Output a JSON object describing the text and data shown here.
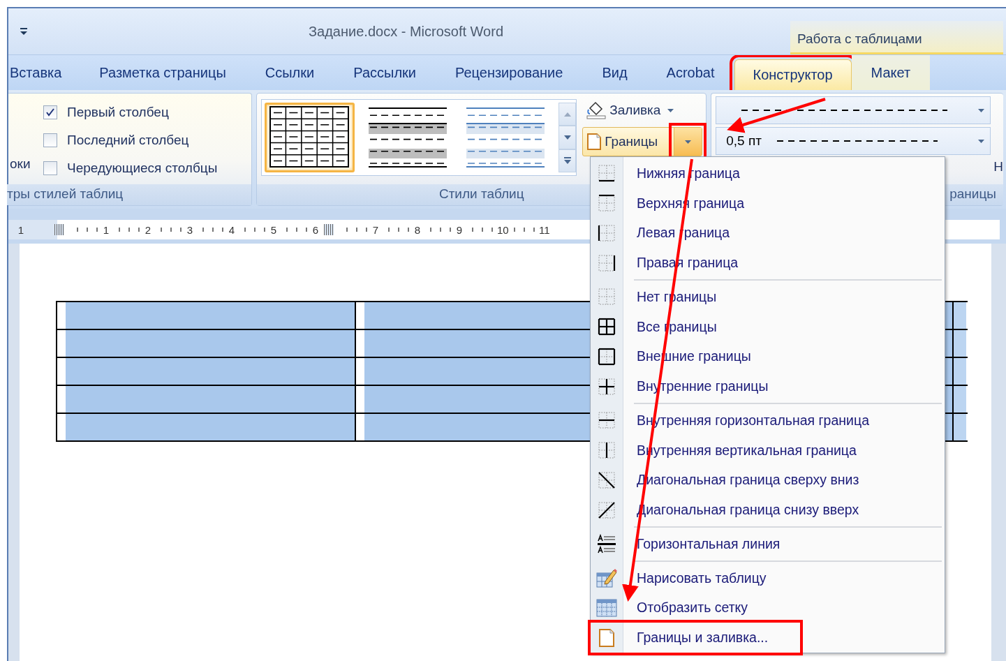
{
  "window": {
    "title": "Задание.docx - Microsoft Word"
  },
  "contextual_group": "Работа с таблицами",
  "tabs": [
    {
      "label": "Вставка",
      "selected": false,
      "contextual": false,
      "marked": false
    },
    {
      "label": "Разметка страницы",
      "selected": false,
      "contextual": false,
      "marked": false
    },
    {
      "label": "Ссылки",
      "selected": false,
      "contextual": false,
      "marked": false
    },
    {
      "label": "Рассылки",
      "selected": false,
      "contextual": false,
      "marked": false
    },
    {
      "label": "Рецензирование",
      "selected": false,
      "contextual": false,
      "marked": false
    },
    {
      "label": "Вид",
      "selected": false,
      "contextual": false,
      "marked": false
    },
    {
      "label": "Acrobat",
      "selected": false,
      "contextual": false,
      "marked": false
    },
    {
      "label": "Конструктор",
      "selected": true,
      "contextual": true,
      "marked": true
    },
    {
      "label": "Макет",
      "selected": false,
      "contextual": true,
      "marked": false
    }
  ],
  "ribbon": {
    "style_options": {
      "cut_label": "оки",
      "options": [
        {
          "label": "Первый столбец",
          "checked": true
        },
        {
          "label": "Последний столбец",
          "checked": false
        },
        {
          "label": "Чередующиеся столбцы",
          "checked": false
        }
      ],
      "group_label": "тры стилей таблиц"
    },
    "table_styles": {
      "styles": [
        {
          "kind": "grid",
          "selected": true
        },
        {
          "kind": "banded_gray",
          "selected": false
        },
        {
          "kind": "banded_blue",
          "selected": false
        }
      ],
      "shading": "Заливка",
      "borders": {
        "label": "Границы",
        "marked": true
      },
      "group_label": "Стили таблиц"
    },
    "draw_borders": {
      "weight": "0,5 пт",
      "cut_button": "Н",
      "group_label": "раницы"
    }
  },
  "ruler": {
    "labels": [
      "1",
      "1",
      "2",
      "3",
      "4",
      "5",
      "6",
      "7",
      "8",
      "9",
      "10",
      "11"
    ]
  },
  "table": {
    "rows": [
      {
        "selected": true
      },
      {
        "selected": true
      },
      {
        "selected": true
      },
      {
        "selected": true
      },
      {
        "selected": true
      }
    ]
  },
  "borders_menu": {
    "sections": [
      [
        {
          "label": "Нижняя граница",
          "marked": false
        },
        {
          "label": "Верхняя граница",
          "marked": false
        },
        {
          "label": "Левая граница",
          "marked": false
        },
        {
          "label": "Правая граница",
          "marked": false
        }
      ],
      [
        {
          "label": "Нет границы",
          "marked": false
        },
        {
          "label": "Все границы",
          "marked": false
        },
        {
          "label": "Внешние границы",
          "marked": false
        },
        {
          "label": "Внутренние границы",
          "marked": false
        }
      ],
      [
        {
          "label": "Внутренняя горизонтальная граница",
          "marked": false
        },
        {
          "label": "Внутренняя вертикальная граница",
          "marked": false
        },
        {
          "label": "Диагональная граница сверху вниз",
          "marked": false
        },
        {
          "label": "Диагональная граница снизу вверх",
          "marked": false
        }
      ],
      [
        {
          "label": "Горизонтальная линия",
          "marked": false
        }
      ],
      [
        {
          "label": "Нарисовать таблицу",
          "marked": false
        },
        {
          "label": "Отобразить сетку",
          "marked": false
        },
        {
          "label": "Границы и заливка...",
          "marked": true
        }
      ]
    ]
  }
}
